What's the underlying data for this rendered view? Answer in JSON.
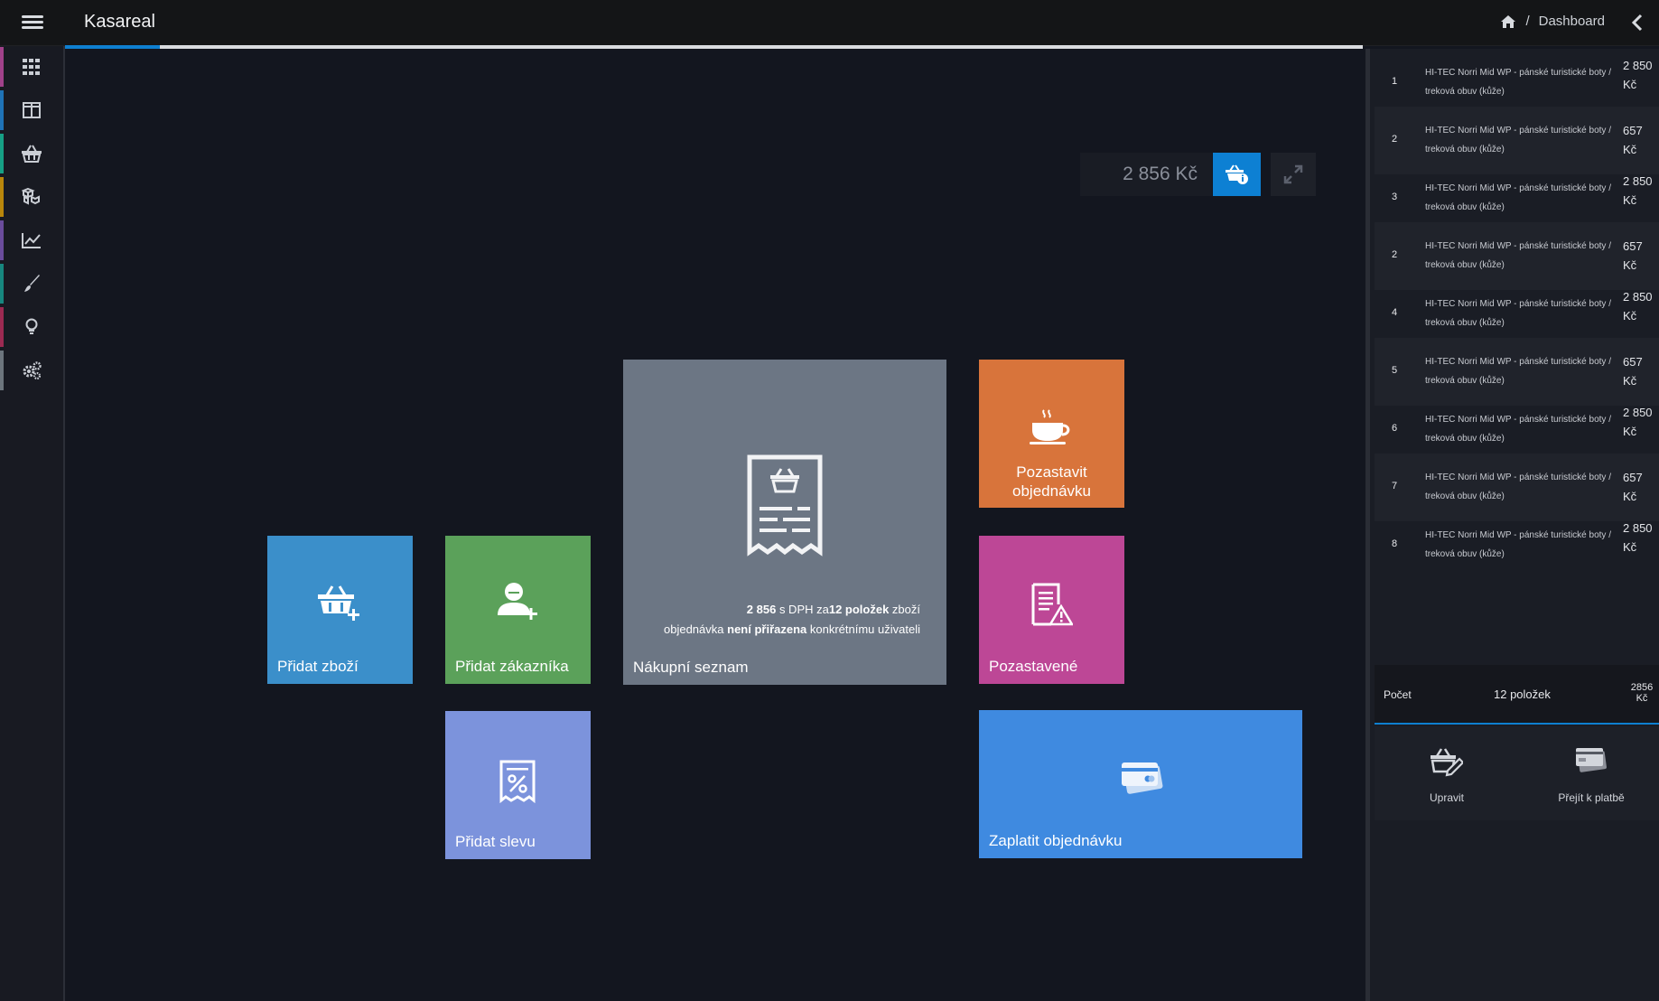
{
  "header": {
    "brand": "Kasareal",
    "breadcrumb_sep": "/",
    "breadcrumb_current": "Dashboard"
  },
  "progress": {
    "percent": 7.3
  },
  "sidebar": {
    "items": [
      {
        "icon": "grid-icon",
        "stripe": "#a0418a"
      },
      {
        "icon": "columns-icon",
        "stripe": "#1f73b7"
      },
      {
        "icon": "basket-icon",
        "stripe": "#16a085"
      },
      {
        "icon": "boxes-icon",
        "stripe": "#b8860b"
      },
      {
        "icon": "chart-line-icon",
        "stripe": "#6a4c9c"
      },
      {
        "icon": "brush-icon",
        "stripe": "#17877f"
      },
      {
        "icon": "lightbulb-icon",
        "stripe": "#9c2a52"
      },
      {
        "icon": "gears-icon",
        "stripe": "#6c757d"
      }
    ]
  },
  "toolbar": {
    "total": "2 856 Kč"
  },
  "tiles": {
    "add_goods": "Přidat zboží",
    "add_customer": "Přidat zákazníka",
    "shopping_list": "Nákupní seznam",
    "pause_line1": "Pozastavit",
    "pause_line2": "objednávku",
    "paused": "Pozastavené",
    "discount": "Přidat slevu",
    "pay": "Zaplatit objednávku",
    "colors": {
      "add_goods": "#3b8fca",
      "add_customer": "#5ba15a",
      "shopping_list": "#6c7684",
      "pause": "#d8743b",
      "paused": "#bd4796",
      "discount": "#7c93dc",
      "pay": "#3f8ae0"
    }
  },
  "summary": {
    "amount": "2 856",
    "mid1": " s DPH za",
    "count": "12 položek",
    "tail1": " zboží",
    "order": "objednávka ",
    "not_assigned": "není přiřazena",
    "tail2": " konkrétnímu uživateli"
  },
  "cart": {
    "items": [
      {
        "num": "1",
        "name": "HI-TEC Norri Mid WP - pánské turistické boty / treková obuv (kůže)",
        "price": "2 850 Kč"
      },
      {
        "num": "2",
        "name": "HI-TEC Norri Mid WP - pánské turistické boty / treková obuv (kůže)",
        "price": "657 Kč"
      },
      {
        "num": "3",
        "name": "HI-TEC Norri Mid WP - pánské turistické boty / treková obuv (kůže)",
        "price": "2 850 Kč"
      },
      {
        "num": "2",
        "name": "HI-TEC Norri Mid WP - pánské turistické boty / treková obuv (kůže)",
        "price": "657 Kč"
      },
      {
        "num": "4",
        "name": "HI-TEC Norri Mid WP - pánské turistické boty / treková obuv (kůže)",
        "price": "2 850 Kč"
      },
      {
        "num": "5",
        "name": "HI-TEC Norri Mid WP - pánské turistické boty / treková obuv (kůže)",
        "price": "657 Kč"
      },
      {
        "num": "6",
        "name": "HI-TEC Norri Mid WP - pánské turistické boty / treková obuv (kůže)",
        "price": "2 850 Kč"
      },
      {
        "num": "7",
        "name": "HI-TEC Norri Mid WP - pánské turistické boty / treková obuv (kůže)",
        "price": "657 Kč"
      },
      {
        "num": "8",
        "name": "HI-TEC Norri Mid WP - pánské turistické boty / treková obuv (kůže)",
        "price": "2 850 Kč"
      }
    ],
    "count_label": "Počet",
    "count_value": "12 položek",
    "sum_value": "2856",
    "sum_currency": "Kč",
    "edit_label": "Upravit",
    "checkout_label": "Přejít k platbě"
  }
}
